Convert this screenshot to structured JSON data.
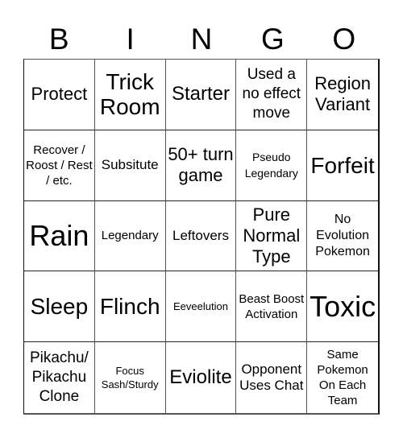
{
  "title_letters": [
    "B",
    "I",
    "N",
    "G",
    "O"
  ],
  "cells": [
    [
      "Protect",
      "Trick Room",
      "Starter",
      "Used a no effect move",
      "Region Variant"
    ],
    [
      "Recover / Roost / Rest / etc.",
      "Subsitute",
      "50+ turn game",
      "Pseudo Legendary",
      "Forfeit"
    ],
    [
      "Rain",
      "Legendary",
      "Leftovers",
      "Pure Normal Type",
      "No Evolution Pokemon"
    ],
    [
      "Sleep",
      "Flinch",
      "Eeveelution",
      "Beast Boost Activation",
      "Toxic"
    ],
    [
      "Pikachu/ Pikachu Clone",
      "Focus Sash/Sturdy",
      "Eviolite",
      "Opponent Uses Chat",
      "Same Pokemon On Each Team"
    ]
  ]
}
